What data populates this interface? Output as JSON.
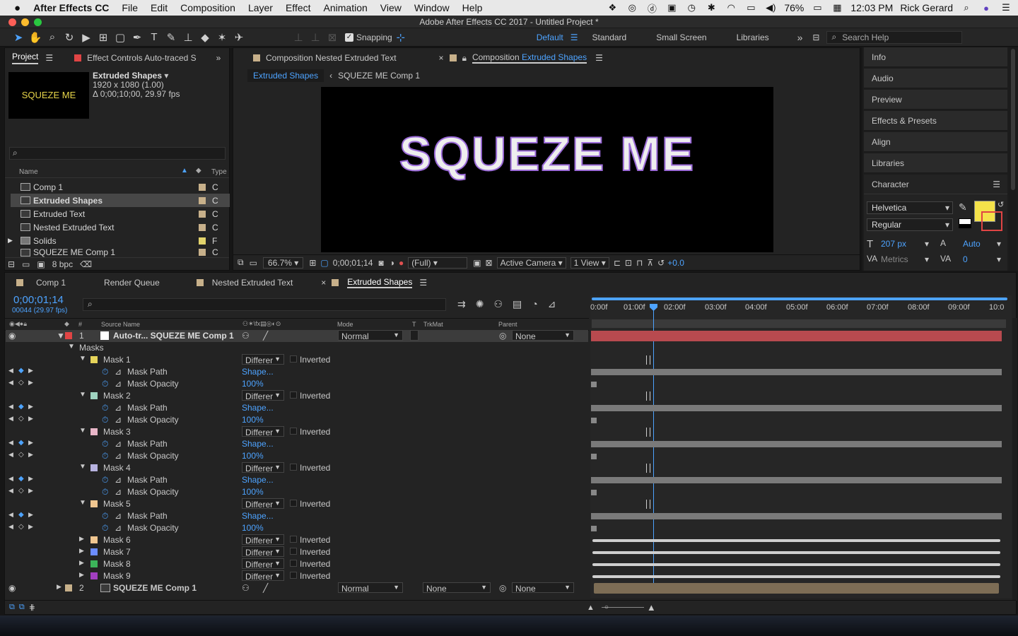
{
  "menubar": {
    "apple": "",
    "app": "After Effects CC",
    "items": [
      "File",
      "Edit",
      "Composition",
      "Layer",
      "Effect",
      "Animation",
      "View",
      "Window",
      "Help"
    ],
    "battery": "76%",
    "time": "12:03 PM",
    "user": "Rick Gerard"
  },
  "window": {
    "title": "Adobe After Effects CC 2017 - Untitled Project *"
  },
  "toolbar": {
    "snapping": "Snapping",
    "workspaces": [
      "Default",
      "Standard",
      "Small Screen",
      "Libraries"
    ],
    "search_placeholder": "Search Help"
  },
  "project": {
    "tab": "Project",
    "effect_tab": "Effect Controls Auto-traced S",
    "thumb_text": "SQUEZE ME",
    "item_name": "Extruded Shapes",
    "item_res": "1920 x 1080 (1.00)",
    "item_dur": "Δ 0;00;10;00, 29.97 fps",
    "col_name": "Name",
    "col_type": "Type",
    "bpc": "8 bpc",
    "items": [
      {
        "name": "Comp 1",
        "type": "C",
        "color": "#c7b08a"
      },
      {
        "name": "Extruded Shapes",
        "type": "C",
        "color": "#c7b08a"
      },
      {
        "name": "Extruded Text",
        "type": "C",
        "color": "#c7b08a"
      },
      {
        "name": "Nested Extruded Text",
        "type": "C",
        "color": "#c7b08a"
      },
      {
        "name": "Solids",
        "type": "F",
        "color": "#e2d36b"
      },
      {
        "name": "SQUEZE ME Comp 1",
        "type": "C",
        "color": "#c7b08a"
      }
    ]
  },
  "comp": {
    "tab1": "Composition Nested Extruded Text",
    "tab2_prefix": "Composition",
    "tab2_name": "Extruded Shapes",
    "crumb1": "Extruded Shapes",
    "crumb2": "SQUEZE ME Comp 1",
    "viewer_text": "SQUEZE ME",
    "zoom": "66.7%",
    "time": "0;00;01;14",
    "resolution": "(Full)",
    "camera": "Active Camera",
    "views": "1 View",
    "exposure": "+0.0"
  },
  "right": {
    "panels": [
      "Info",
      "Audio",
      "Preview",
      "Effects & Presets",
      "Align",
      "Libraries"
    ],
    "character": "Character",
    "font": "Helvetica",
    "style": "Regular",
    "size": "207 px",
    "leading": "Auto",
    "tracking_mode": "Metrics",
    "tracking": "0",
    "fill_color": "#f4e24a"
  },
  "timeline": {
    "tabs": [
      "Comp 1",
      "Render Queue",
      "Nested Extruded Text",
      "Extruded Shapes"
    ],
    "timecode": "0;00;01;14",
    "frames": "00044 (29.97 fps)",
    "col_source": "Source Name",
    "col_mode": "Mode",
    "col_t": "T",
    "col_trkmat": "TrkMat",
    "col_parent": "Parent",
    "ruler": [
      "0:00f",
      "01:00f",
      "02:00f",
      "03:00f",
      "04:00f",
      "05:00f",
      "06:00f",
      "07:00f",
      "08:00f",
      "09:00f",
      "10:0"
    ],
    "layer1": {
      "num": "1",
      "name": "Auto-tr... SQUEZE ME Comp 1",
      "mode": "Normal",
      "parent": "None"
    },
    "masks_label": "Masks",
    "masks": [
      {
        "name": "Mask 1",
        "color": "#e6d45a",
        "mode": "Differer",
        "inv": "Inverted",
        "path": "Mask Path",
        "path_val": "Shape...",
        "op": "Mask Opacity",
        "op_val": "100%"
      },
      {
        "name": "Mask 2",
        "color": "#9fd3c0",
        "mode": "Differer",
        "inv": "Inverted",
        "path": "Mask Path",
        "path_val": "Shape...",
        "op": "Mask Opacity",
        "op_val": "100%"
      },
      {
        "name": "Mask 3",
        "color": "#e8b6c8",
        "mode": "Differer",
        "inv": "Inverted",
        "path": "Mask Path",
        "path_val": "Shape...",
        "op": "Mask Opacity",
        "op_val": "100%"
      },
      {
        "name": "Mask 4",
        "color": "#b7b3e0",
        "mode": "Differer",
        "inv": "Inverted",
        "path": "Mask Path",
        "path_val": "Shape...",
        "op": "Mask Opacity",
        "op_val": "100%"
      },
      {
        "name": "Mask 5",
        "color": "#f0c690",
        "mode": "Differer",
        "inv": "Inverted",
        "path": "Mask Path",
        "path_val": "Shape...",
        "op": "Mask Opacity",
        "op_val": "100%"
      }
    ],
    "collapsed": [
      {
        "name": "Mask 6",
        "color": "#f0c690",
        "mode": "Differer",
        "inv": "Inverted"
      },
      {
        "name": "Mask 7",
        "color": "#6b8cff",
        "mode": "Differer",
        "inv": "Inverted"
      },
      {
        "name": "Mask 8",
        "color": "#3cb35a",
        "mode": "Differer",
        "inv": "Inverted"
      },
      {
        "name": "Mask 9",
        "color": "#a13fc0",
        "mode": "Differer",
        "inv": "Inverted"
      }
    ],
    "layer2": {
      "num": "2",
      "name": "SQUEZE ME Comp 1",
      "mode": "Normal",
      "trkmat": "None",
      "parent": "None"
    }
  }
}
